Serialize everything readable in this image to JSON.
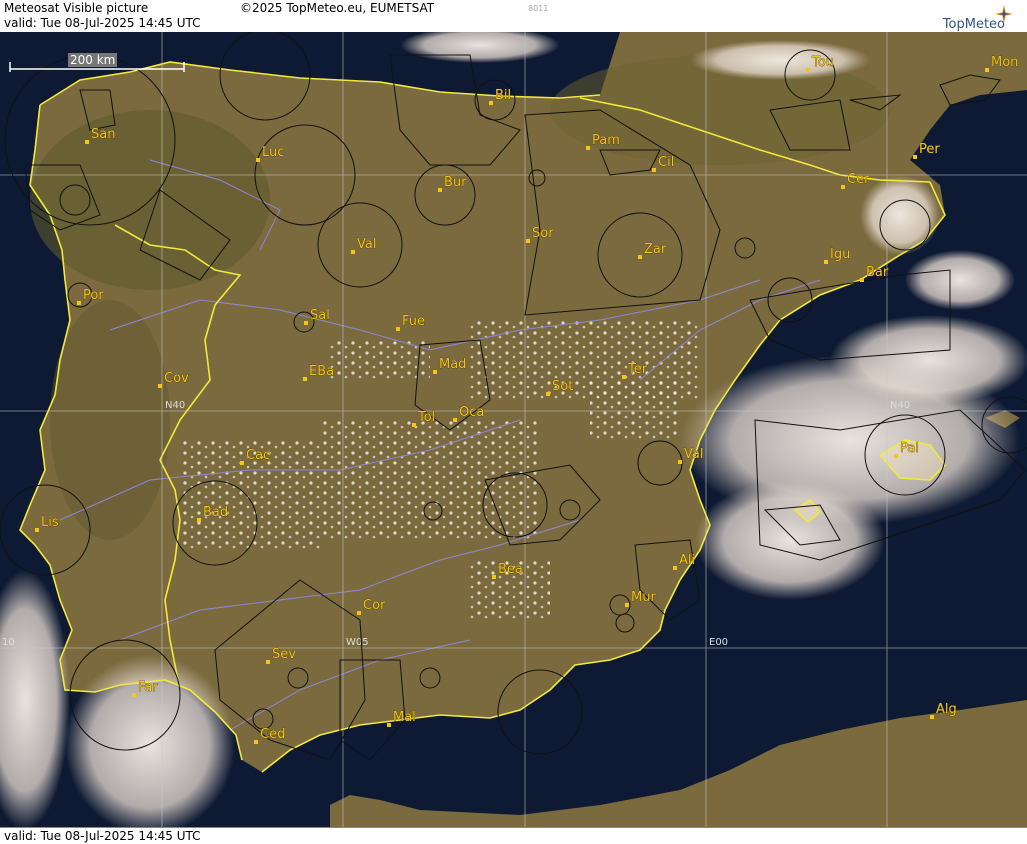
{
  "header": {
    "title": "Meteosat Visible picture",
    "copyright": "©2025 TopMeteo.eu, EUMETSAT",
    "code": "8011",
    "valid": "valid:  Tue  08-Jul-2025  14:45 UTC",
    "logo": "TopMeteo"
  },
  "footer": {
    "valid": "valid:  Tue  08-Jul-2025  14:45 UTC"
  },
  "scale": {
    "label": "200 km"
  },
  "grid_labels": {
    "n40_west": "N40",
    "n40_east": "N40",
    "w05": "W05",
    "e00": "E00",
    "w10": "10"
  },
  "cities": [
    {
      "name": "San"
    },
    {
      "name": "Luc"
    },
    {
      "name": "Bil"
    },
    {
      "name": "Pam"
    },
    {
      "name": "Tou"
    },
    {
      "name": "Mon"
    },
    {
      "name": "Per"
    },
    {
      "name": "Cil"
    },
    {
      "name": "Bur"
    },
    {
      "name": "Cer"
    },
    {
      "name": "Val"
    },
    {
      "name": "Sor"
    },
    {
      "name": "Zar"
    },
    {
      "name": "Igu"
    },
    {
      "name": "Bar"
    },
    {
      "name": "Por"
    },
    {
      "name": "Sal"
    },
    {
      "name": "Fue"
    },
    {
      "name": "Mad"
    },
    {
      "name": "Ter"
    },
    {
      "name": "Cov"
    },
    {
      "name": "EBa"
    },
    {
      "name": "Sot"
    },
    {
      "name": "Tol"
    },
    {
      "name": "Oca"
    },
    {
      "name": "Cac"
    },
    {
      "name": "Val"
    },
    {
      "name": "Pal"
    },
    {
      "name": "Bad"
    },
    {
      "name": "Lis"
    },
    {
      "name": "Ali"
    },
    {
      "name": "Bea"
    },
    {
      "name": "Mur"
    },
    {
      "name": "Cor"
    },
    {
      "name": "Sev"
    },
    {
      "name": "Far"
    },
    {
      "name": "Mal"
    },
    {
      "name": "Ced"
    },
    {
      "name": "Alg"
    }
  ],
  "colors": {
    "land": "#7a6a3e",
    "sea": "#0e1a33",
    "cloud": "#efe7e0",
    "border": "#f2ea3a",
    "river": "#8e86d8",
    "airspace": "#111111"
  }
}
